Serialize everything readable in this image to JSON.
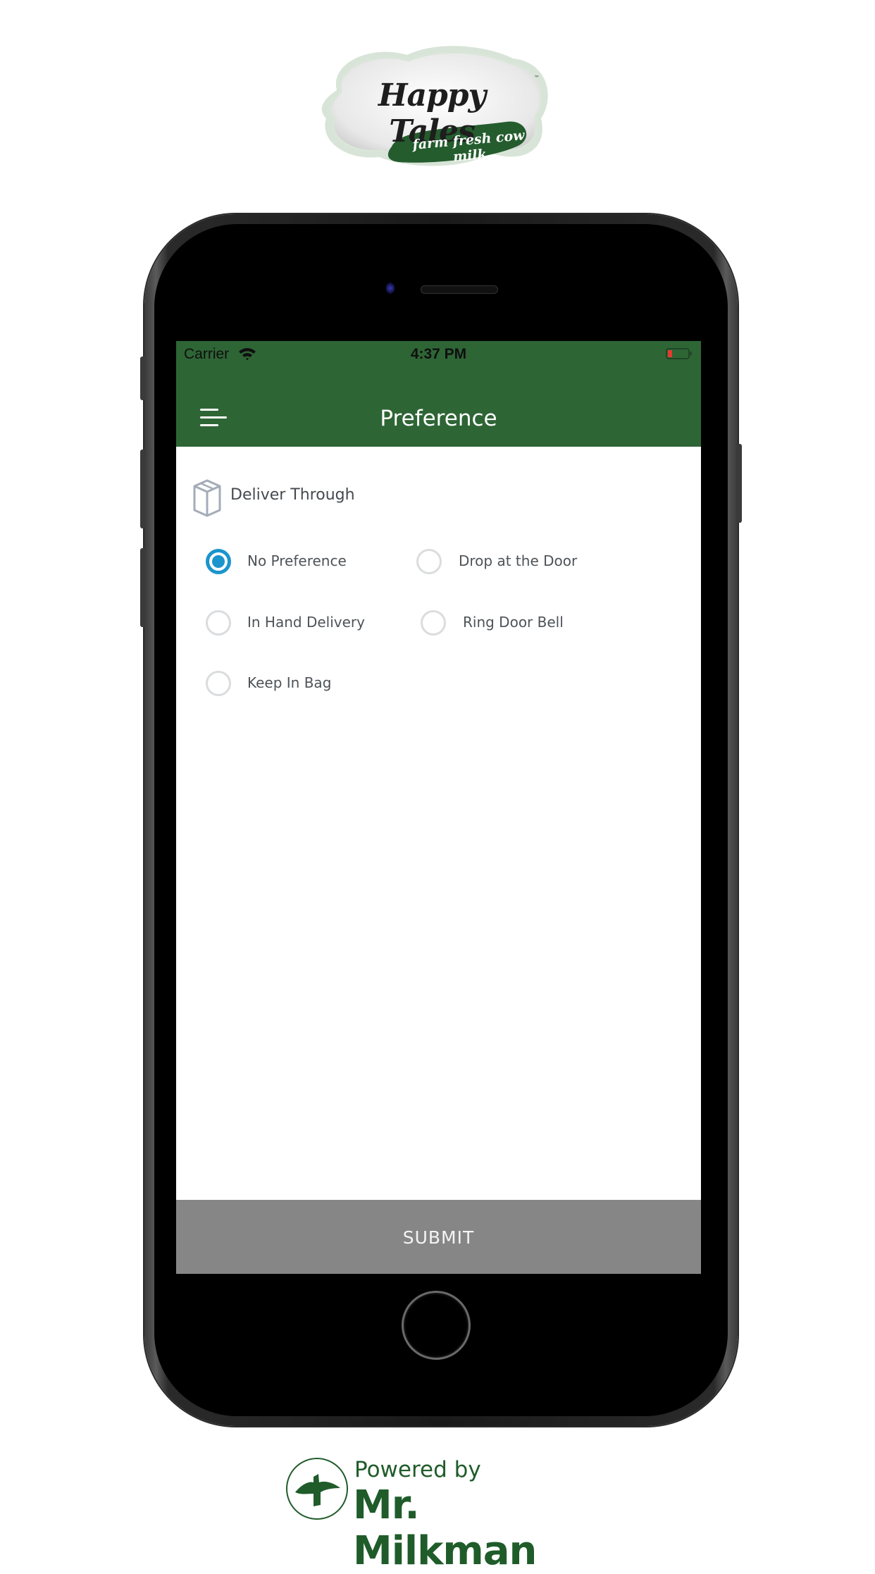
{
  "brand": {
    "name": "Happy Tales",
    "trademark": "™",
    "tagline": "farm fresh cow milk"
  },
  "status_bar": {
    "carrier": "Carrier",
    "time": "4:37 PM",
    "wifi_icon": "wifi-icon",
    "battery_icon": "battery-low-icon"
  },
  "nav": {
    "menu_icon": "hamburger-menu-icon",
    "title": "Preference"
  },
  "section": {
    "icon": "box-icon",
    "title": "Deliver Through"
  },
  "options": [
    {
      "label": "No Preference",
      "checked": true
    },
    {
      "label": "Drop at the Door",
      "checked": false
    },
    {
      "label": "In Hand Delivery",
      "checked": false
    },
    {
      "label": "Ring Door Bell",
      "checked": false
    },
    {
      "label": "Keep In Bag",
      "checked": false
    }
  ],
  "submit": {
    "label": "SUBMIT"
  },
  "footer": {
    "powered_by": "Powered by",
    "company": "Mr. Milkman"
  },
  "colors": {
    "primary_green": "#2e6535",
    "radio_selected": "#1b95cc",
    "radio_unselected": "#dadcde",
    "submit_bg": "#868686",
    "footer_green": "#1f5c2a"
  }
}
